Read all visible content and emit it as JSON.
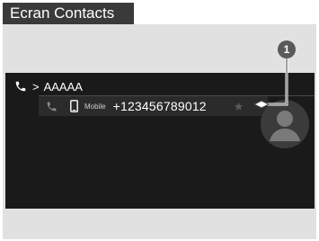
{
  "title": "Ecran Contacts",
  "breadcrumb": {
    "icon": "phone-icon",
    "separator": ">",
    "contact_name": "AAAAA"
  },
  "entry": {
    "call_icon": "phone-icon",
    "type_icon": "mobile-phone-icon",
    "type_label": "Mobile",
    "number": "+123456789012",
    "favorite_icon": "star-icon"
  },
  "avatar_icon": "person-silhouette-icon",
  "callout": {
    "number": "1"
  },
  "colors": {
    "title_bg": "#3a3a3a",
    "frame_bg": "#e1e1e1",
    "screen_bg": "#1a1a1a",
    "row_bg": "#2b2b2b",
    "callout_bg": "#5a5a5a",
    "text": "#ffffff"
  }
}
